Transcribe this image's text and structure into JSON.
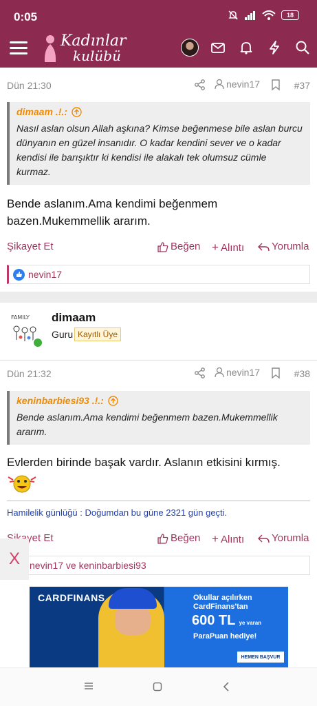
{
  "status": {
    "time": "0:05",
    "battery": "18"
  },
  "app": {
    "logo_line1": "Kadınlar",
    "logo_line2": "kulübü"
  },
  "post1": {
    "date": "Dün 21:30",
    "user": "nevin17",
    "number": "#37",
    "quote_author": "dimaam .!.:",
    "quote_text": "Nasıl aslan olsun Allah aşkına? Kimse beğenmese bile aslan burcu dünyanın en güzel insanıdır. O kadar kendini sever ve o kadar kendisi ile barışıktır ki kendisi ile alakalı tek olumsuz cümle kurmaz.",
    "message": "Bende aslanım.Ama kendimi beğenmem bazen.Mukemmellik ararım.",
    "report": "Şikayet Et",
    "like": "Beğen",
    "quote_action": "Alıntı",
    "reply": "Yorumla",
    "likers": "nevin17"
  },
  "post2": {
    "author": "dimaam",
    "role": "Guru",
    "badge": "Kayıtlı Üye",
    "date": "Dün 21:32",
    "user": "nevin17",
    "number": "#38",
    "quote_author": "keninbarbiesi93 .!.:",
    "quote_text": "Bende aslanım.Ama kendimi beğenmem bazen.Mukemmellik ararım.",
    "message": "Evlerden birinde başak vardır. Aslanın etkisini kırmış.",
    "signature": "Hamilelik günlüğü : Doğumdan bu güne 2321 gün geçti.",
    "report": "Şikayet Et",
    "like": "Beğen",
    "quote_action": "Alıntı",
    "reply": "Yorumla",
    "likers": "nevin17 ve keninbarbiesi93"
  },
  "ad": {
    "brand": "CARDFINANS",
    "line1": "Okullar açılırken",
    "line1b": "CardFinans'tan",
    "amount": "600 TL",
    "amount_suffix": "ye varan",
    "line3": "ParaPuan hediye!",
    "cta": "HEMEN BAŞVUR",
    "close": "X"
  },
  "colors": {
    "brand": "#8c2a50",
    "accent": "#a0365e",
    "quote_author": "#f08a00",
    "signature": "#1f3fb5"
  }
}
